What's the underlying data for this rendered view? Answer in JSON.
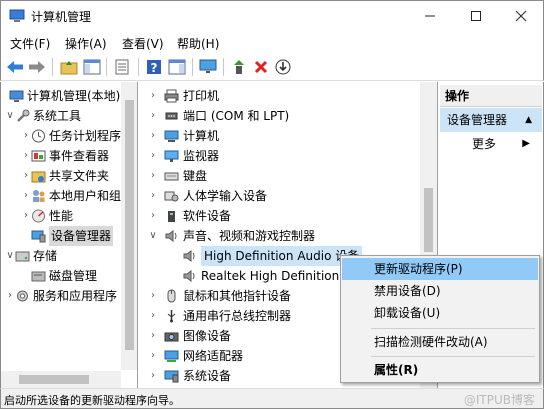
{
  "window": {
    "title": "计算机管理"
  },
  "menubar": [
    "文件(F)",
    "操作(A)",
    "查看(V)",
    "帮助(H)"
  ],
  "toolbar_icons": [
    "back-arrow",
    "forward-arrow",
    "folder-up",
    "show-hide-tree",
    "properties",
    "help",
    "action-pane",
    "monitor",
    "update-driver",
    "delete-x",
    "scan-down"
  ],
  "left_tree": [
    {
      "label": "计算机管理(本地)",
      "level": 0,
      "expander": "",
      "icon": "computer-management-icon"
    },
    {
      "label": "系统工具",
      "level": 1,
      "expander": "v",
      "icon": "tools-icon"
    },
    {
      "label": "任务计划程序",
      "level": 2,
      "expander": ">",
      "icon": "clock-icon"
    },
    {
      "label": "事件查看器",
      "level": 2,
      "expander": ">",
      "icon": "event-viewer-icon"
    },
    {
      "label": "共享文件夹",
      "level": 2,
      "expander": ">",
      "icon": "shared-folder-icon"
    },
    {
      "label": "本地用户和组",
      "level": 2,
      "expander": ">",
      "icon": "users-icon"
    },
    {
      "label": "性能",
      "level": 2,
      "expander": ">",
      "icon": "performance-icon"
    },
    {
      "label": "设备管理器",
      "level": 2,
      "expander": "",
      "icon": "device-manager-icon",
      "selected": true
    },
    {
      "label": "存储",
      "level": 1,
      "expander": "v",
      "icon": "storage-icon"
    },
    {
      "label": "磁盘管理",
      "level": 2,
      "expander": "",
      "icon": "disk-icon"
    },
    {
      "label": "服务和应用程序",
      "level": 1,
      "expander": ">",
      "icon": "services-icon"
    }
  ],
  "device_tree": [
    {
      "label": "打印机",
      "expander": ">",
      "icon": "printer-icon",
      "indent": 0
    },
    {
      "label": "端口 (COM 和 LPT)",
      "expander": ">",
      "icon": "port-icon",
      "indent": 0
    },
    {
      "label": "计算机",
      "expander": ">",
      "icon": "computer-icon",
      "indent": 0
    },
    {
      "label": "监视器",
      "expander": ">",
      "icon": "monitor-icon",
      "indent": 0
    },
    {
      "label": "键盘",
      "expander": ">",
      "icon": "keyboard-icon",
      "indent": 0
    },
    {
      "label": "人体学输入设备",
      "expander": ">",
      "icon": "hid-icon",
      "indent": 0
    },
    {
      "label": "软件设备",
      "expander": ">",
      "icon": "software-device-icon",
      "indent": 0
    },
    {
      "label": "声音、视频和游戏控制器",
      "expander": "v",
      "icon": "speaker-icon",
      "indent": 0
    },
    {
      "label": "High Definition Audio 设备",
      "expander": "",
      "icon": "speaker-icon",
      "indent": 1,
      "selected": true
    },
    {
      "label": "Realtek High Definition Audio",
      "expander": "",
      "icon": "speaker-icon",
      "indent": 1
    },
    {
      "label": "鼠标和其他指针设备",
      "expander": ">",
      "icon": "mouse-icon",
      "indent": 0
    },
    {
      "label": "通用串行总线控制器",
      "expander": ">",
      "icon": "usb-icon",
      "indent": 0
    },
    {
      "label": "图像设备",
      "expander": ">",
      "icon": "camera-icon",
      "indent": 0
    },
    {
      "label": "网络适配器",
      "expander": ">",
      "icon": "network-icon",
      "indent": 0
    },
    {
      "label": "系统设备",
      "expander": ">",
      "icon": "system-device-icon",
      "indent": 0
    }
  ],
  "actions": {
    "header": "操作",
    "selected": "设备管理器",
    "more": "更多"
  },
  "context_menu": {
    "items": [
      {
        "label": "更新驱动程序(P)",
        "bold": false
      },
      {
        "label": "禁用设备(D)",
        "bold": false
      },
      {
        "label": "卸载设备(U)",
        "bold": false
      },
      {
        "label": "扫描检测硬件改动(A)",
        "bold": false
      },
      {
        "label": "属性(R)",
        "bold": true
      }
    ]
  },
  "status_text": "启动所选设备的更新驱动程序向导。",
  "watermark": "@ITPUB博客",
  "colors": {
    "selection": "#cce4f7",
    "hover": "#91c9f7",
    "menu_bg": "#f2f2f2"
  }
}
